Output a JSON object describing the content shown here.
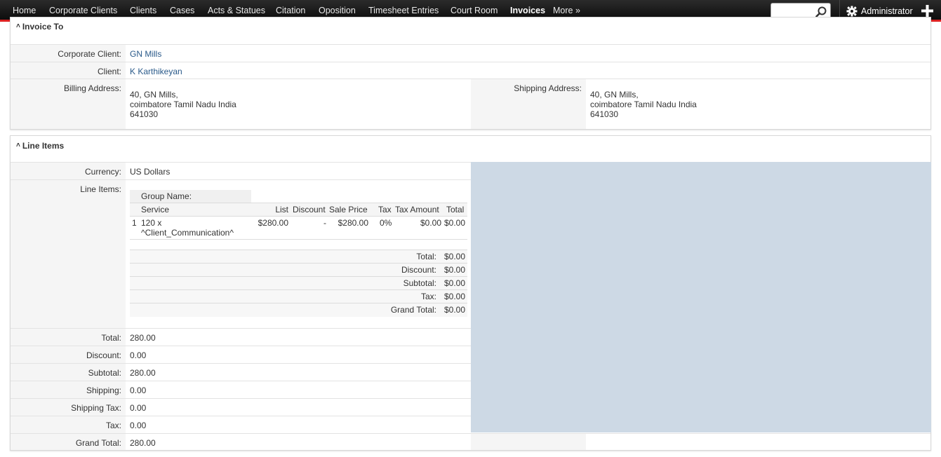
{
  "nav": {
    "items": [
      "Home",
      "Corporate Clients",
      "Clients",
      "Cases",
      "Acts & Statues",
      "Citation",
      "Oposition",
      "Timesheet Entries",
      "Court Room",
      "Invoices",
      "More »"
    ],
    "active": "Invoices",
    "search_value": "",
    "user": "Administrator"
  },
  "invoice_to": {
    "heading": "Invoice To",
    "corporate_client_label": "Corporate Client:",
    "corporate_client": "GN Mills",
    "client_label": "Client:",
    "client": "K Karthikeyan",
    "billing_label": "Billing Address:",
    "billing": [
      "40, GN Mills,",
      "coimbatore Tamil Nadu  India",
      "641030"
    ],
    "shipping_label": "Shipping Address:",
    "shipping": [
      "40, GN Mills,",
      "coimbatore Tamil Nadu  India",
      "641030"
    ]
  },
  "line_items": {
    "heading": "Line Items",
    "currency_label": "Currency:",
    "currency": "US Dollars",
    "line_items_label": "Line Items:",
    "group_name_label": "Group Name:",
    "columns": {
      "service": "Service",
      "list": "List",
      "discount": "Discount",
      "sale_price": "Sale Price",
      "tax": "Tax",
      "tax_amount": "Tax Amount",
      "total": "Total"
    },
    "rows": [
      {
        "num": "1",
        "service_line1": "120 x",
        "service_line2": "^Client_Communication^",
        "list": "$280.00",
        "discount": "-",
        "sale_price": "$280.00",
        "tax": "0%",
        "tax_amount": "$0.00",
        "total": "$0.00"
      }
    ],
    "summary": [
      {
        "label": "Total:",
        "value": "$0.00"
      },
      {
        "label": "Discount:",
        "value": "$0.00"
      },
      {
        "label": "Subtotal:",
        "value": "$0.00"
      },
      {
        "label": "Tax:",
        "value": "$0.00"
      },
      {
        "label": "Grand Total:",
        "value": "$0.00"
      }
    ],
    "totals": [
      {
        "label": "Total:",
        "value": "280.00"
      },
      {
        "label": "Discount:",
        "value": "0.00"
      },
      {
        "label": "Subtotal:",
        "value": "280.00"
      },
      {
        "label": "Shipping:",
        "value": "0.00"
      },
      {
        "label": "Shipping Tax:",
        "value": "0.00"
      },
      {
        "label": "Tax:",
        "value": "0.00"
      },
      {
        "label": "Grand Total:",
        "value": "280.00"
      }
    ]
  },
  "colors": {
    "nav_accent": "#dd2222",
    "link": "#2a5a8a",
    "label_bg": "#f5f5f5",
    "blank_panel": "#cdd9e5"
  }
}
